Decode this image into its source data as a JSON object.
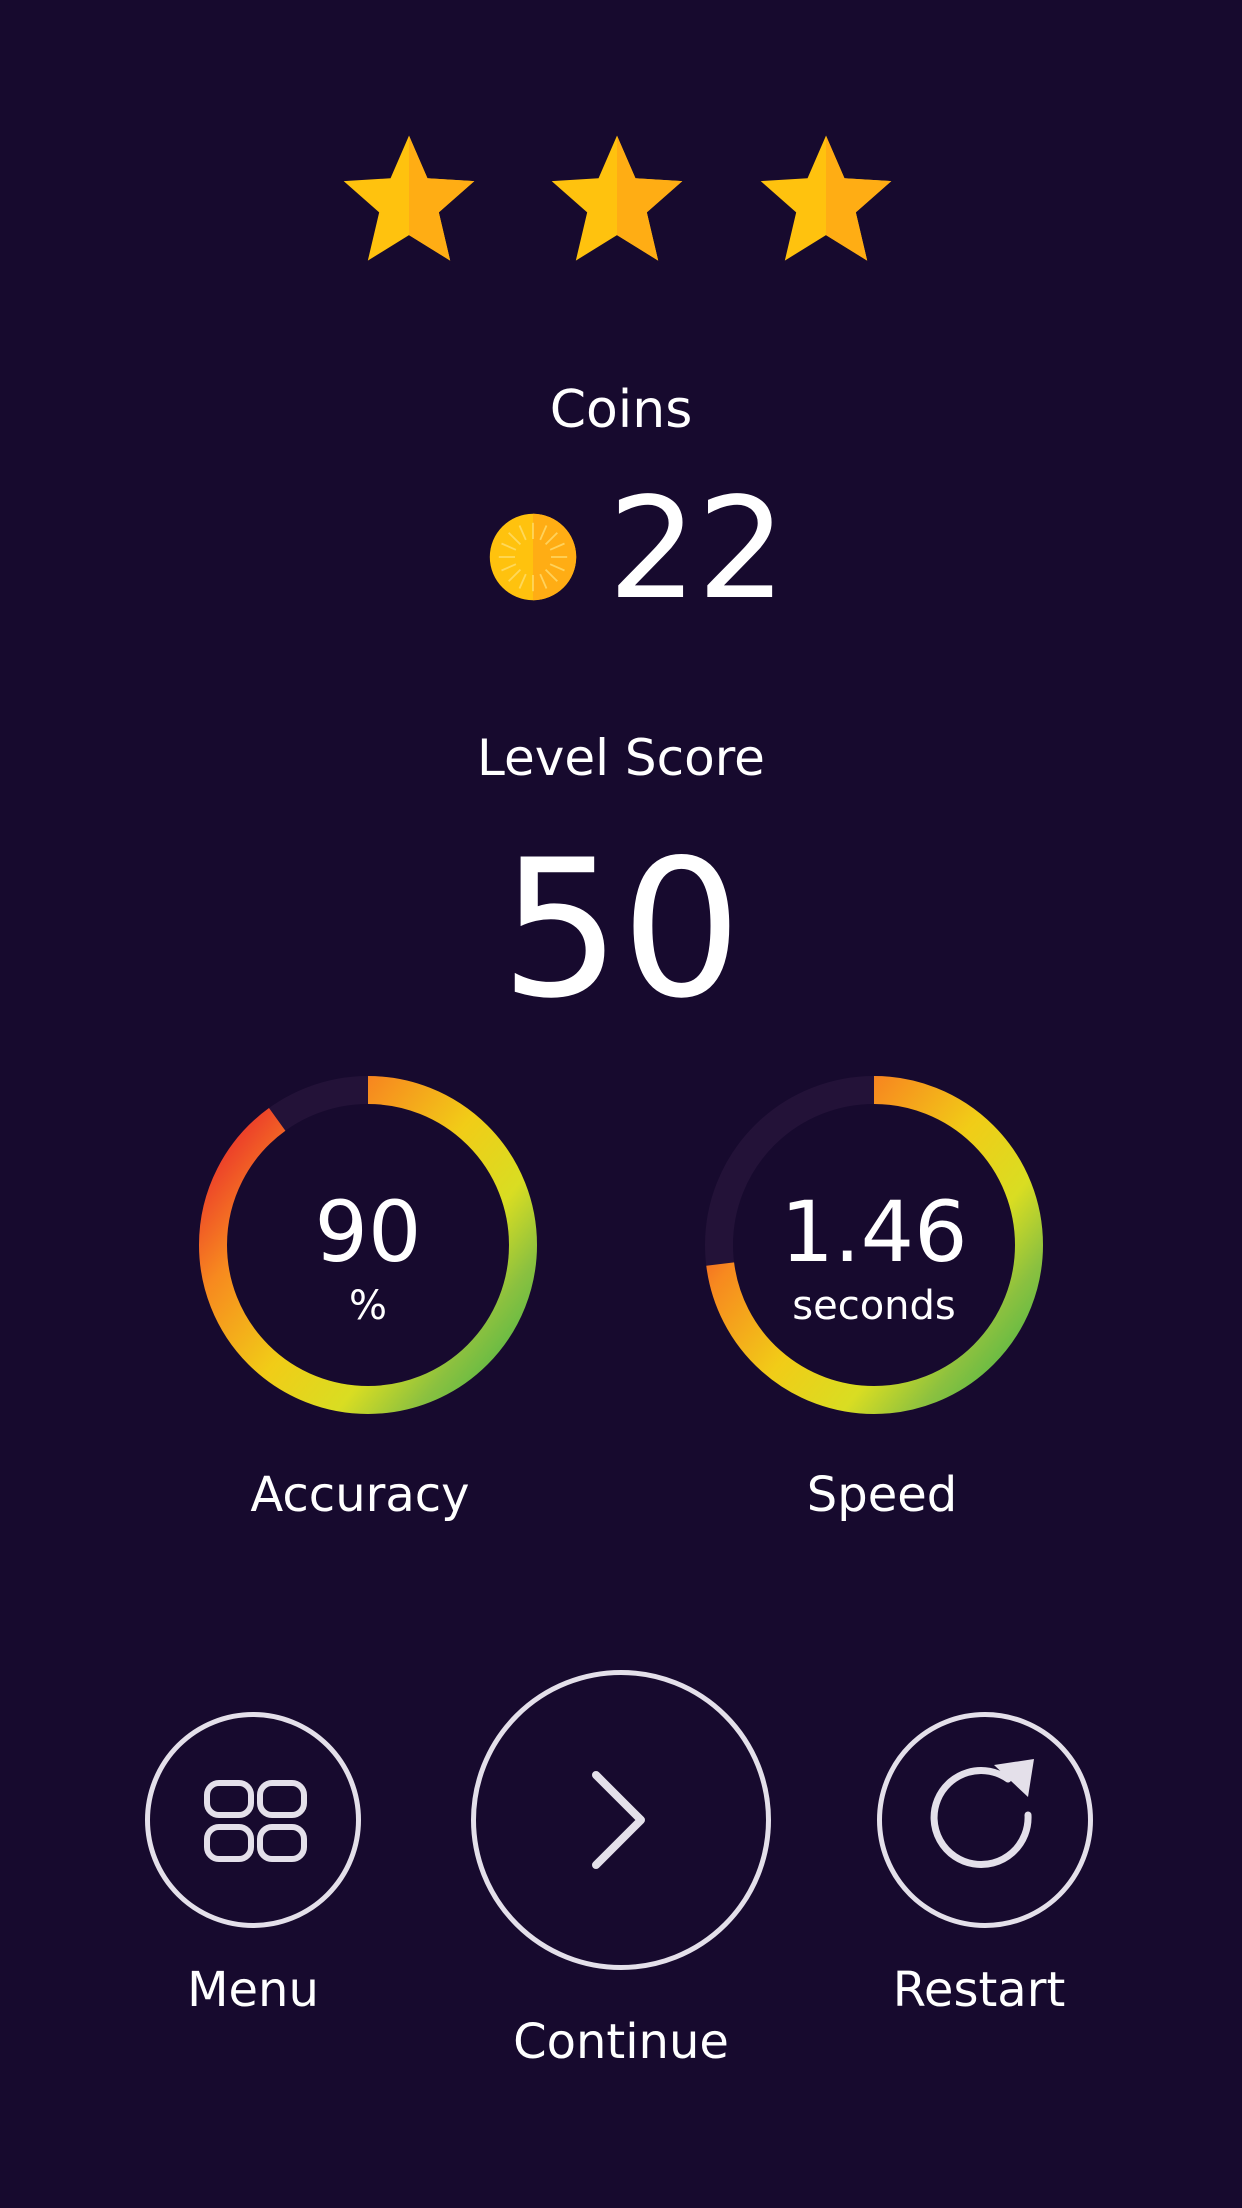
{
  "rating": {
    "stars_earned": 3,
    "stars_total": 3,
    "star_color": "#ffc20e",
    "star_icon": "star-icon"
  },
  "coins": {
    "label": "Coins",
    "value": "22",
    "icon": "coin-icon",
    "coin_color": "#ffc20e"
  },
  "level_score": {
    "label": "Level Score",
    "value": "50"
  },
  "accuracy": {
    "label": "Accuracy",
    "value": "90",
    "unit": "%",
    "fill_fraction": 0.9
  },
  "speed": {
    "label": "Speed",
    "value": "1.46",
    "unit": "seconds",
    "fill_fraction": 0.73
  },
  "gauge_colors": {
    "track": "#231238",
    "gradient": [
      "#e8222e",
      "#f7891f",
      "#f1cc17",
      "#e4e01f",
      "#a9c93a",
      "#4db748"
    ]
  },
  "buttons": {
    "menu": {
      "label": "Menu",
      "icon": "grid-icon"
    },
    "continue": {
      "label": "Continue",
      "icon": "chevron-right-icon"
    },
    "restart": {
      "label": "Restart",
      "icon": "restart-icon"
    }
  },
  "colors": {
    "background": "#170a2e",
    "text": "#ffffff",
    "button_outline": "#e4e0ea"
  }
}
